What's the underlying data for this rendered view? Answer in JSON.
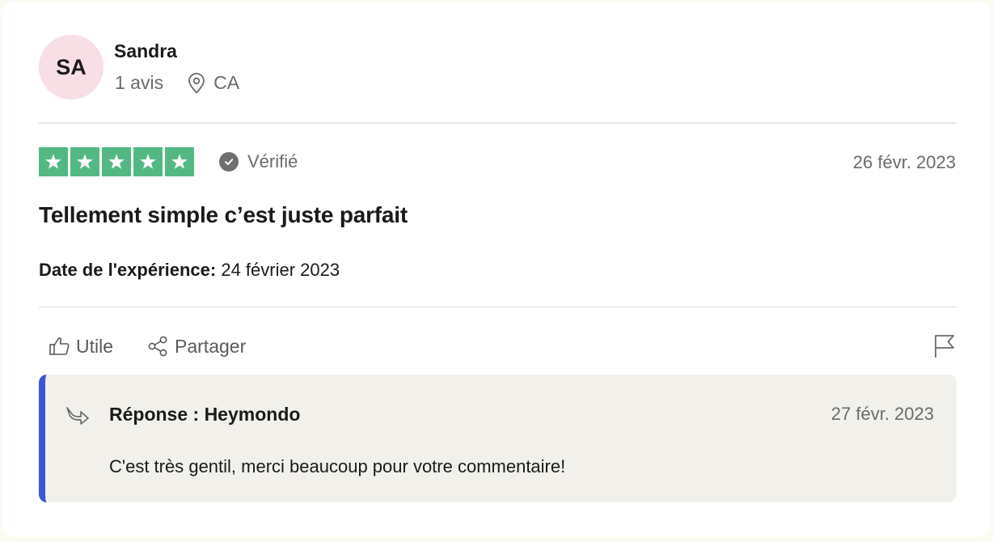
{
  "reviewer": {
    "initials": "SA",
    "name": "Sandra",
    "review_count": "1 avis",
    "country": "CA",
    "avatar_color": "#f8dee5"
  },
  "review": {
    "rating": 5,
    "rating_max": 5,
    "star_color": "#54b884",
    "verified_label": "Vérifié",
    "date": "26 févr. 2023",
    "title": "Tellement simple c’est juste parfait",
    "experience_label": "Date de l'expérience:",
    "experience_date": "24 février 2023"
  },
  "actions": {
    "useful_label": "Utile",
    "share_label": "Partager",
    "flag_icon": "flag-icon"
  },
  "reply": {
    "title": "Réponse : Heymondo",
    "date": "27 févr. 2023",
    "text": "C'est très gentil, merci beaucoup pour votre commentaire!",
    "accent_color": "#3c57d3"
  }
}
